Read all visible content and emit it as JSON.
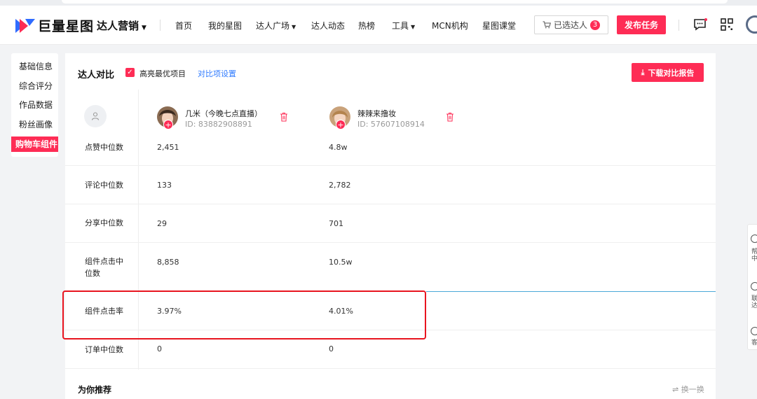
{
  "brand": {
    "logo_text": "巨量星图",
    "product": "达人营销",
    "accent": "#fe2c55"
  },
  "nav": {
    "items": [
      {
        "label": "首页"
      },
      {
        "label": "我的星图"
      },
      {
        "label": "达人广场",
        "has_dropdown": true
      },
      {
        "label": "达人动态"
      },
      {
        "label": "热榜"
      },
      {
        "label": "工具",
        "has_dropdown": true
      },
      {
        "label": "MCN机构"
      },
      {
        "label": "星图课堂"
      }
    ],
    "cart_label": "已选达人",
    "cart_count": "3",
    "publish_label": "发布任务"
  },
  "sidebar": {
    "items": [
      {
        "label": "基础信息",
        "active": false
      },
      {
        "label": "综合评分",
        "active": false
      },
      {
        "label": "作品数据",
        "active": false
      },
      {
        "label": "粉丝画像",
        "active": false
      },
      {
        "label": "购物车组件",
        "active": true
      }
    ]
  },
  "compare": {
    "title": "达人对比",
    "highlight_label": "高亮最优项目",
    "highlight_checked": true,
    "settings_link": "对比项设置",
    "download_label": "下载对比报告",
    "influencers": [
      {
        "name": "几米（今晚七点直播）",
        "id": "ID: 83882908891"
      },
      {
        "name": "辣辣来撸妆",
        "id": "ID: 57607108914"
      }
    ],
    "rows": [
      {
        "label": "点赞中位数",
        "values": [
          "2,451",
          "4.8w"
        ]
      },
      {
        "label": "评论中位数",
        "values": [
          "133",
          "2,782"
        ]
      },
      {
        "label": "分享中位数",
        "values": [
          "29",
          "701"
        ]
      },
      {
        "label": "组件点击中位数",
        "label_lines": [
          "组件点击中",
          "位数"
        ],
        "values": [
          "8,858",
          "10.5w"
        ]
      },
      {
        "label": "组件点击率",
        "values": [
          "3.97%",
          "4.01%"
        ]
      },
      {
        "label": "订单中位数",
        "values": [
          "0",
          "0"
        ]
      }
    ]
  },
  "recommend": {
    "title": "为你推荐",
    "refresh_label": "换一换"
  },
  "float_panel": {
    "items": [
      "帮中",
      "联达",
      "客"
    ]
  }
}
